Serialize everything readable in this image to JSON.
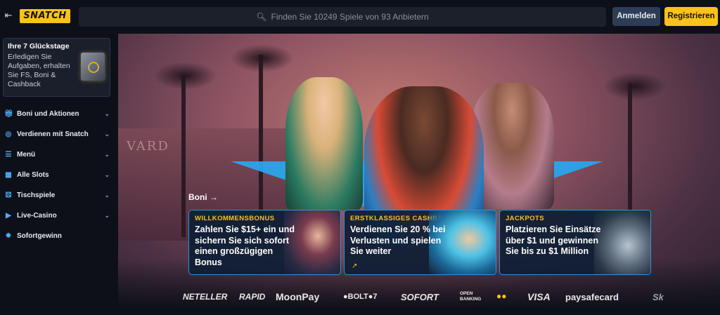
{
  "topbar": {
    "logo": "SNATCH",
    "search_placeholder": "Finden Sie 10249 Spiele von 93 Anbietern",
    "login_label": "Anmelden",
    "register_label": "Registrieren"
  },
  "sidebar": {
    "lucky": {
      "title": "Ihre 7 Glückstage",
      "text": "Erledigen Sie Aufgaben, erhalten Sie FS, Boni & Cashback"
    },
    "items": [
      {
        "label": "Boni und Aktionen",
        "icon": "gift-icon",
        "has_chevron": true
      },
      {
        "label": "Verdienen mit Snatch",
        "icon": "coins-icon",
        "has_chevron": true
      },
      {
        "label": "Menü",
        "icon": "menu-icon",
        "has_chevron": true
      },
      {
        "label": "Alle Slots",
        "icon": "slot-icon",
        "has_chevron": true
      },
      {
        "label": "Tischspiele",
        "icon": "dice-icon",
        "has_chevron": true
      },
      {
        "label": "Live-Casino",
        "icon": "live-icon",
        "has_chevron": true
      },
      {
        "label": "Sofortgewinn",
        "icon": "sparkle-icon",
        "has_chevron": false
      }
    ]
  },
  "hero": {
    "boni_link": "Boni →",
    "sign_text": "VARD",
    "cards": [
      {
        "label": "WILLKOMMENSBONUS",
        "text": "Zahlen Sie $15+ ein und sichern Sie sich sofort einen großzügigen Bonus"
      },
      {
        "label": "ERSTKLASSIGES CASHBACK",
        "text": "Verdienen Sie 20 % bei Verlusten und spielen Sie weiter",
        "arrow": "↗"
      },
      {
        "label": "JACKPOTS",
        "text": "Platzieren Sie Einsätze über $1 und gewinnen Sie bis zu $1 Million"
      }
    ]
  },
  "payments": [
    "NETELLER",
    "RAPID",
    "MoonPay",
    "●BOLT●7",
    "SOFORT",
    "OPEN BANKING",
    "●●",
    "VISA",
    "paysafecard",
    "Sk"
  ],
  "colors": {
    "accent": "#ffc21a",
    "card_border": "#3a8fd0",
    "background": "#0d1018"
  }
}
